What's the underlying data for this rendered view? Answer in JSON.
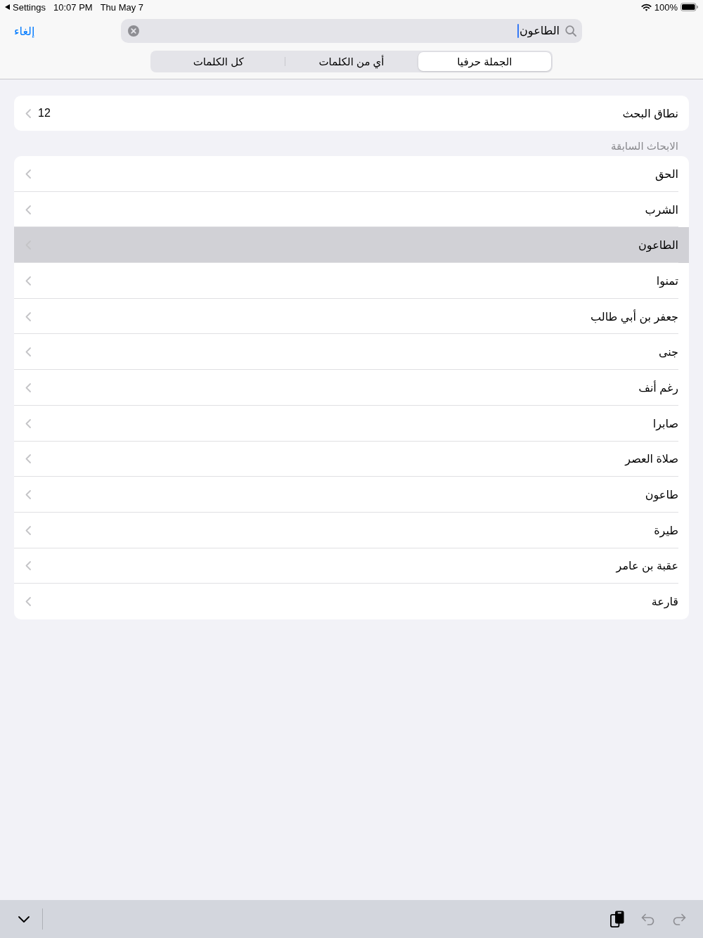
{
  "status_bar": {
    "back_label": "Settings",
    "time": "10:07 PM",
    "date": "Thu May 7",
    "battery": "100%"
  },
  "nav": {
    "cancel": "إلغاء",
    "search": {
      "value": "الطاعون",
      "focused": true
    }
  },
  "scope_tabs": [
    {
      "label": "الجملة حرفيا",
      "selected": true
    },
    {
      "label": "أي من الكلمات",
      "selected": false
    },
    {
      "label": "كل الكلمات",
      "selected": false
    }
  ],
  "search_scope": {
    "label": "نطاق البحث",
    "value": "12"
  },
  "recent_searches": {
    "title": "الابحاث السابقة",
    "items": [
      {
        "label": "الحق",
        "selected": false
      },
      {
        "label": "الشرب",
        "selected": false
      },
      {
        "label": "الطاعون",
        "selected": true
      },
      {
        "label": "تمنوا",
        "selected": false
      },
      {
        "label": "جعفر بن أبي طالب",
        "selected": false
      },
      {
        "label": "جنى",
        "selected": false
      },
      {
        "label": "رغم أنف",
        "selected": false
      },
      {
        "label": "صابرا",
        "selected": false
      },
      {
        "label": "صلاة العصر",
        "selected": false
      },
      {
        "label": "طاعون",
        "selected": false
      },
      {
        "label": "طيرة",
        "selected": false
      },
      {
        "label": "عقبة بن عامر",
        "selected": false
      },
      {
        "label": "قارعة",
        "selected": false
      }
    ]
  },
  "keyboard_toolbar": {
    "paste": {
      "disabled": false
    },
    "undo": {
      "disabled": true
    },
    "redo": {
      "disabled": true
    }
  }
}
